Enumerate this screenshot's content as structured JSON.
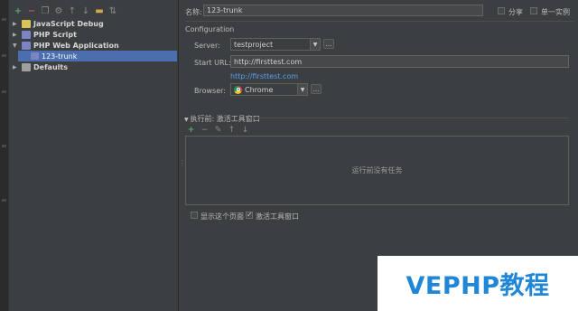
{
  "toolbar": {
    "icons": [
      "add-icon",
      "remove-icon",
      "copy-icon",
      "settings-icon",
      "move-up-icon",
      "move-down-icon",
      "folder-icon",
      "sort-icon"
    ]
  },
  "tree": {
    "items": [
      {
        "label": "JavaScript Debug",
        "expanded": false
      },
      {
        "label": "PHP Script",
        "expanded": false
      },
      {
        "label": "PHP Web Application",
        "expanded": true,
        "children": [
          {
            "label": "123-trunk",
            "selected": true
          }
        ]
      },
      {
        "label": "Defaults",
        "expanded": false
      }
    ]
  },
  "form": {
    "name_label": "名称:",
    "name_value": "123-trunk",
    "share_label": "分享",
    "single_instance_label": "单一实例",
    "section_title": "Configuration",
    "server_label": "Server:",
    "server_value": "testproject",
    "start_url_label": "Start URL:",
    "start_url_value": "http://firsttest.com",
    "url_link": "http://firsttest.com",
    "browser_label": "Browser:",
    "browser_value": "Chrome",
    "dots_label": "..."
  },
  "before_launch": {
    "title": "执行前: 激活工具窗口",
    "empty_text": "运行前没有任务",
    "show_page_label": "显示这个页面",
    "activate_tool_label": "激活工具窗口",
    "show_page_checked": false,
    "activate_tool_checked": true
  },
  "watermark": {
    "text": "VEPHP教程"
  },
  "colors": {
    "background": "#3c3f41",
    "selection": "#4b6eaf",
    "link": "#589df6",
    "watermark": "#1f86d8"
  }
}
